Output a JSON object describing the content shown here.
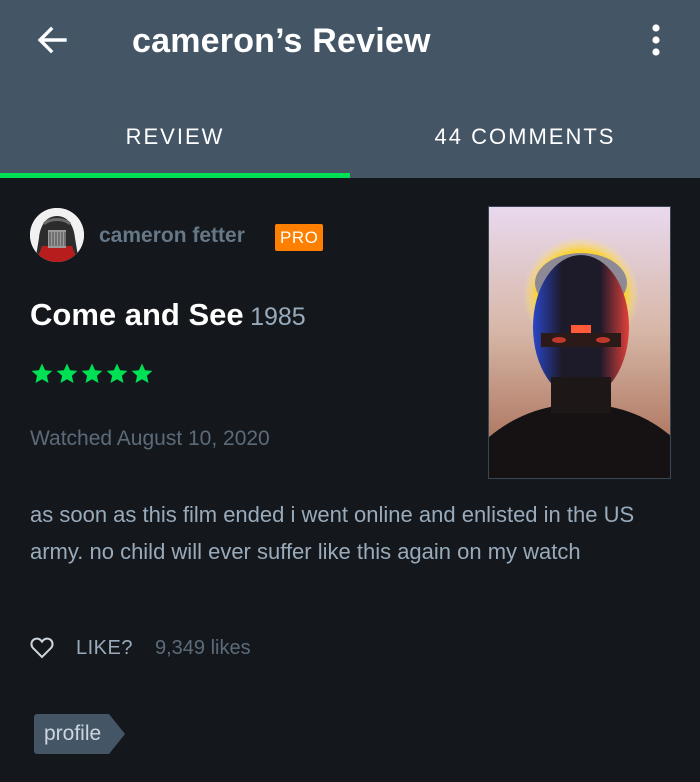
{
  "header": {
    "title": "cameron’s Review",
    "back_icon": "back-arrow-icon",
    "more_icon": "more-vertical-icon"
  },
  "tabs": [
    {
      "label": "REVIEW",
      "active": true
    },
    {
      "label": "44 COMMENTS",
      "active": false
    }
  ],
  "reviewer": {
    "name": "cameron fetter",
    "badge": "PRO"
  },
  "film": {
    "title": "Come and See",
    "year": "1985"
  },
  "rating": {
    "stars": 5,
    "max": 5
  },
  "watched": "Watched August 10, 2020",
  "review": {
    "text": "as soon as this film ended i went online and enlisted in the US army. no child will ever suffer like this again on my watch"
  },
  "likes": {
    "prompt": "LIKE?",
    "count": "9,349 likes"
  },
  "tag": {
    "label": "profile"
  },
  "colors": {
    "background": "#14181c",
    "header": "#445566",
    "accent": "#00e054",
    "badge": "#ff8000",
    "secondary_text": "#99aabb",
    "muted_text": "#5c6b7a"
  }
}
